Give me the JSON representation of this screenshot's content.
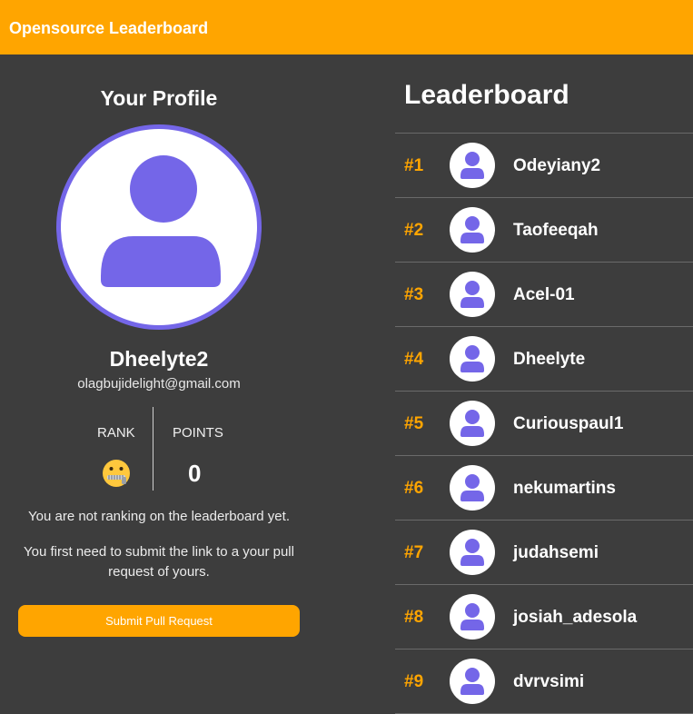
{
  "app": {
    "title": "Opensource Leaderboard",
    "accent_color": "#ffa500",
    "avatar_color": "#7466e8"
  },
  "profile": {
    "heading": "Your Profile",
    "avatar_icon": "user-icon",
    "username": "Dheelyte2",
    "email": "olagbujidelight@gmail.com",
    "rank_label": "RANK",
    "rank_icon": "zipper-mouth-face-emoji",
    "points_label": "POINTS",
    "points_value": "0",
    "message_not_ranking": "You are not ranking on the leaderboard yet.",
    "message_instructions": "You first need to submit the link to a your pull request of yours.",
    "submit_label": "Submit Pull Request"
  },
  "leaderboard": {
    "heading": "Leaderboard",
    "entries": [
      {
        "rank": "#1",
        "name": "Odeyiany2"
      },
      {
        "rank": "#2",
        "name": "Taofeeqah"
      },
      {
        "rank": "#3",
        "name": "Acel-01"
      },
      {
        "rank": "#4",
        "name": "Dheelyte"
      },
      {
        "rank": "#5",
        "name": "Curiouspaul1"
      },
      {
        "rank": "#6",
        "name": "nekumartins"
      },
      {
        "rank": "#7",
        "name": "judahsemi"
      },
      {
        "rank": "#8",
        "name": "josiah_adesola"
      },
      {
        "rank": "#9",
        "name": "dvrvsimi"
      }
    ]
  }
}
